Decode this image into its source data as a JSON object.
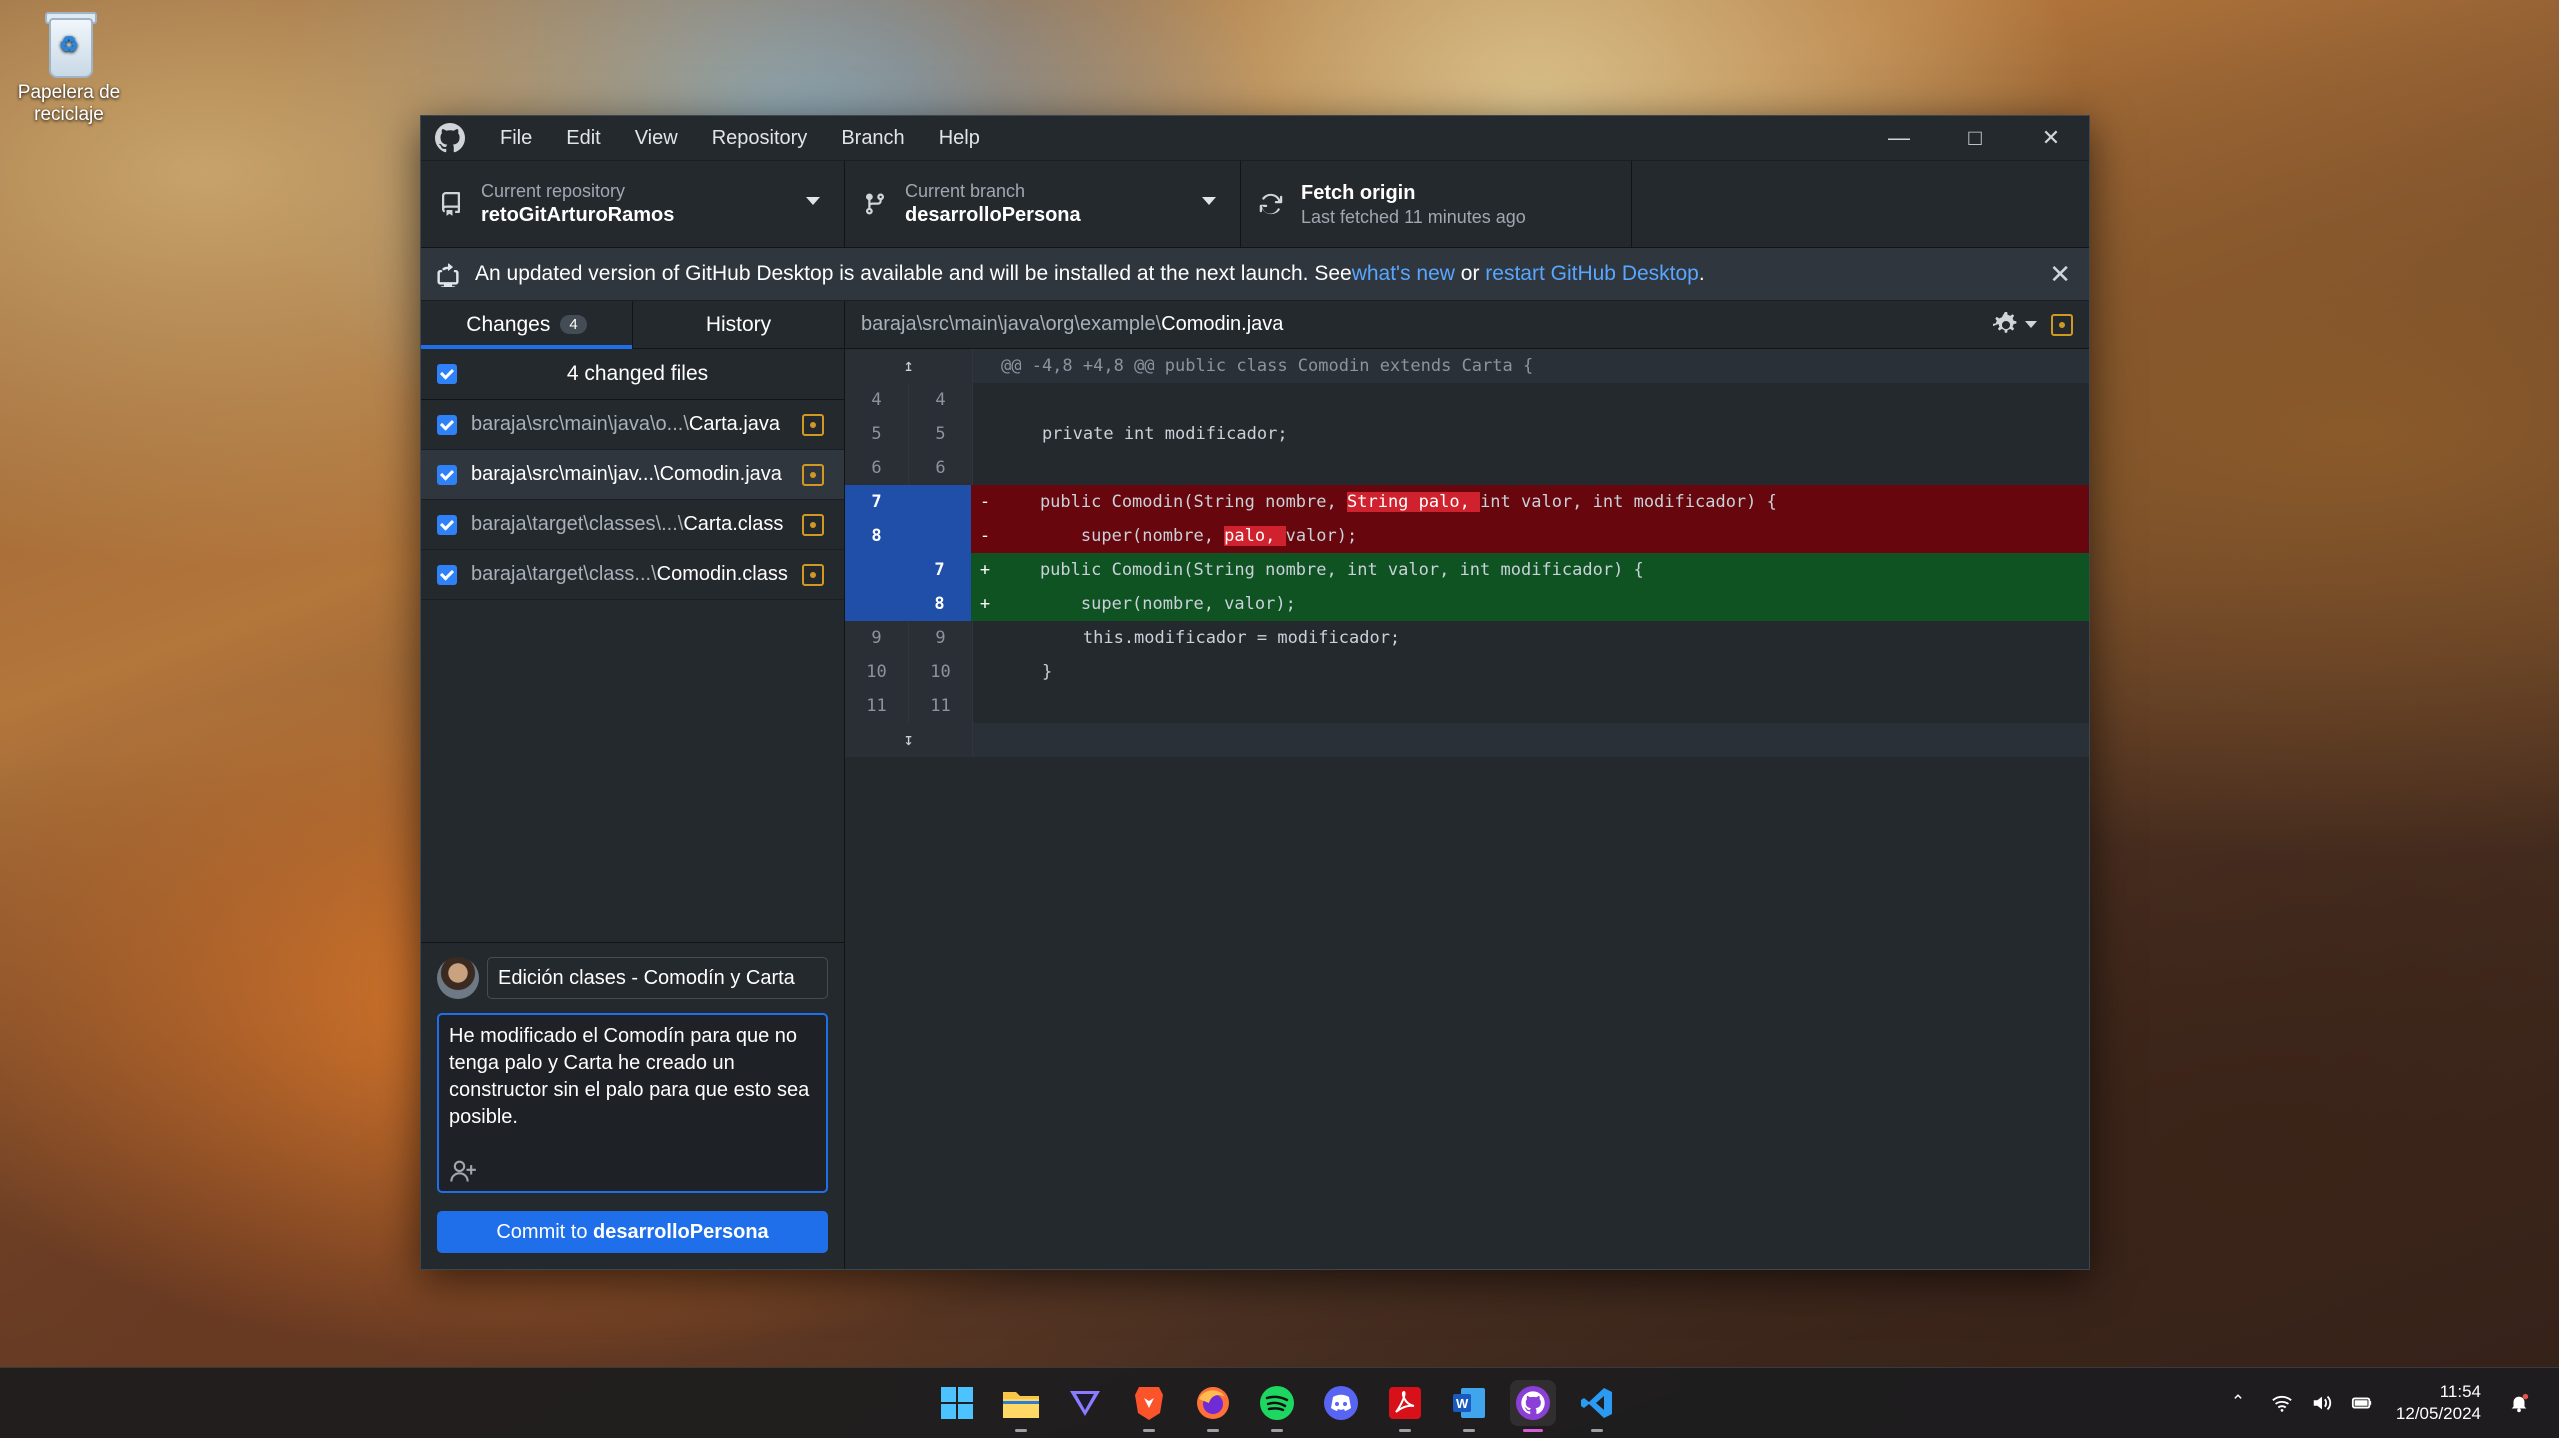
{
  "desktop": {
    "recycle_bin_label": "Papelera de reciclaje"
  },
  "window": {
    "menu": [
      "File",
      "Edit",
      "View",
      "Repository",
      "Branch",
      "Help"
    ]
  },
  "toolbar": {
    "repo_label": "Current repository",
    "repo_value": "retoGitArturoRamos",
    "branch_label": "Current branch",
    "branch_value": "desarrolloPersona",
    "fetch_label": "Fetch origin",
    "fetch_sub": "Last fetched 11 minutes ago"
  },
  "banner": {
    "text": "An updated version of GitHub Desktop is available and will be installed at the next launch. See ",
    "link1": "what's new",
    "mid": " or ",
    "link2": "restart GitHub Desktop",
    "end": "."
  },
  "sidebar": {
    "tab_changes": "Changes",
    "changes_count": "4",
    "tab_history": "History",
    "changed_files_label": "4 changed files",
    "files": [
      {
        "dir": "baraja\\src\\main\\java\\o...\\",
        "name": "Carta.java"
      },
      {
        "dir": "baraja\\src\\main\\jav...\\",
        "name": "Comodin.java"
      },
      {
        "dir": "baraja\\target\\classes\\...\\",
        "name": "Carta.class"
      },
      {
        "dir": "baraja\\target\\class...\\",
        "name": "Comodin.class"
      }
    ]
  },
  "commit": {
    "summary": "Edición clases - Comodín y Carta",
    "description": "He modificado el Comodín para que no tenga palo y Carta he creado un constructor sin el palo para que esto sea posible.",
    "button_prefix": "Commit to ",
    "button_branch": "desarrolloPersona"
  },
  "diff": {
    "path_dir": "baraja\\src\\main\\java\\org\\example\\",
    "path_file": "Comodin.java",
    "hunk_header": "@@ -4,8 +4,8 @@ public class Comodin extends Carta {",
    "lines": [
      {
        "old": "4",
        "new": "4",
        "sign": "",
        "text": ""
      },
      {
        "old": "5",
        "new": "5",
        "sign": "",
        "text": "    private int modificador;"
      },
      {
        "old": "6",
        "new": "6",
        "sign": "",
        "text": ""
      },
      {
        "old": "7",
        "new": "",
        "sign": "-",
        "pre": "    public Comodin(String nombre, ",
        "hl": "String palo, ",
        "post": "int valor, int modificador) {"
      },
      {
        "old": "8",
        "new": "",
        "sign": "-",
        "pre": "        super(nombre, ",
        "hl": "palo, ",
        "post": "valor);"
      },
      {
        "old": "",
        "new": "7",
        "sign": "+",
        "text": "    public Comodin(String nombre, int valor, int modificador) {"
      },
      {
        "old": "",
        "new": "8",
        "sign": "+",
        "text": "        super(nombre, valor);"
      },
      {
        "old": "9",
        "new": "9",
        "sign": "",
        "text": "        this.modificador = modificador;"
      },
      {
        "old": "10",
        "new": "10",
        "sign": "",
        "text": "    }"
      },
      {
        "old": "11",
        "new": "11",
        "sign": "",
        "text": ""
      }
    ]
  },
  "taskbar": {
    "apps": [
      "windows-start",
      "file-explorer",
      "proton-vpn",
      "brave",
      "firefox",
      "spotify",
      "discord",
      "acrobat",
      "word",
      "github-desktop",
      "vscode"
    ],
    "time": "11:54",
    "date": "12/05/2024"
  },
  "colors": {
    "accent": "#1f6feb",
    "deleted": "#67060c",
    "added": "#0f5323",
    "modified": "#d29922"
  }
}
